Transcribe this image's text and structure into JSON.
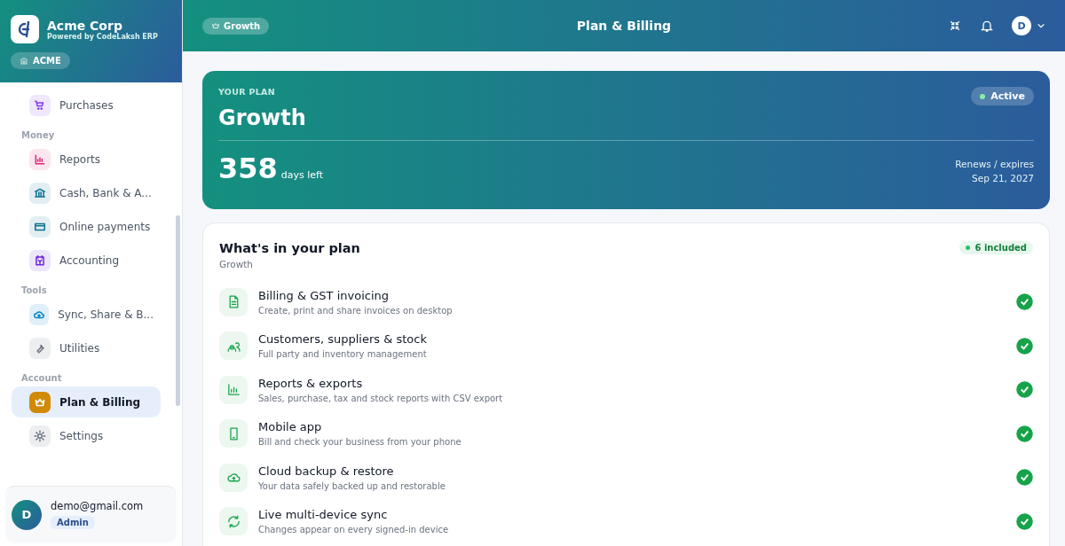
{
  "sidebar": {
    "company": "Acme Corp",
    "powered_by": "Powered by CodeLaksh ERP",
    "org_badge": "ACME",
    "sections": [
      {
        "items": [
          {
            "label": "Purchases",
            "kind": "cart",
            "color": "#7c3aed",
            "selected": false
          }
        ]
      },
      {
        "title": "Money",
        "items": [
          {
            "label": "Reports",
            "kind": "chart",
            "color": "#db2777",
            "selected": false
          },
          {
            "label": "Cash, Bank & A...",
            "kind": "bank",
            "color": "#0e7490",
            "selected": false
          },
          {
            "label": "Online payments",
            "kind": "card",
            "color": "#0e7490",
            "selected": false
          },
          {
            "label": "Accounting",
            "kind": "ledger",
            "color": "#6d28d9",
            "selected": false
          }
        ]
      },
      {
        "title": "Tools",
        "items": [
          {
            "label": "Sync, Share & B...",
            "kind": "cloud",
            "color": "#0284c7",
            "selected": false
          },
          {
            "label": "Utilities",
            "kind": "wrench",
            "color": "#6b7280",
            "selected": false
          }
        ]
      },
      {
        "title": "Account",
        "items": [
          {
            "label": "Plan & Billing",
            "kind": "crown",
            "color": "#ffffff",
            "selected": true
          },
          {
            "label": "Settings",
            "kind": "gear",
            "color": "#6b7280",
            "selected": false
          }
        ]
      }
    ],
    "user": {
      "initial": "D",
      "email": "demo@gmail.com",
      "role": "Admin"
    }
  },
  "header": {
    "plan_chip": "Growth",
    "title": "Plan & Billing",
    "avatar": "D"
  },
  "plan": {
    "eyebrow": "YOUR PLAN",
    "name": "Growth",
    "status": "Active",
    "active": true,
    "days": "358",
    "days_label": "days left",
    "renew_label": "Renews / expires",
    "renew_date": "Sep 21, 2027"
  },
  "features": {
    "title": "What's in your plan",
    "subtitle": "Growth",
    "count": "6 included",
    "items": [
      {
        "kind": "document",
        "title": "Billing & GST invoicing",
        "desc": "Create, print and share invoices on desktop",
        "included": true
      },
      {
        "kind": "people",
        "title": "Customers, suppliers & stock",
        "desc": "Full party and inventory management",
        "included": true
      },
      {
        "kind": "chart",
        "title": "Reports & exports",
        "desc": "Sales, purchase, tax and stock reports with CSV export",
        "included": true
      },
      {
        "kind": "phone",
        "title": "Mobile app",
        "desc": "Bill and check your business from your phone",
        "included": true
      },
      {
        "kind": "cloud",
        "title": "Cloud backup & restore",
        "desc": "Your data safely backed up and restorable",
        "included": true
      },
      {
        "kind": "sync",
        "title": "Live multi-device sync",
        "desc": "Changes appear on every signed-in device",
        "included": true
      }
    ]
  }
}
